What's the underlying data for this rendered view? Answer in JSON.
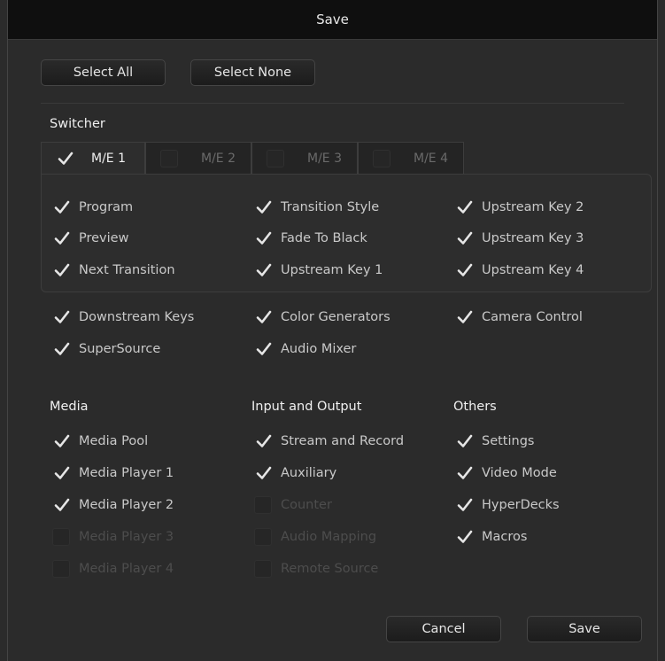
{
  "window": {
    "title": "Save"
  },
  "top_buttons": {
    "select_all": "Select All",
    "select_none": "Select None"
  },
  "switcher": {
    "title": "Switcher",
    "tabs": [
      {
        "label": "M/E 1",
        "checked": true
      },
      {
        "label": "M/E 2",
        "checked": false
      },
      {
        "label": "M/E 3",
        "checked": false
      },
      {
        "label": "M/E 4",
        "checked": false
      }
    ],
    "panel_items": [
      [
        "Program",
        "Transition Style",
        "Upstream Key 2"
      ],
      [
        "Preview",
        "Fade To Black",
        "Upstream Key 3"
      ],
      [
        "Next Transition",
        "Upstream Key 1",
        "Upstream Key 4"
      ]
    ],
    "extra_items": [
      [
        "Downstream Keys",
        "Color Generators",
        "Camera Control"
      ],
      [
        "SuperSource",
        "Audio Mixer"
      ]
    ]
  },
  "media": {
    "title": "Media",
    "items": [
      {
        "label": "Media Pool",
        "checked": true
      },
      {
        "label": "Media Player 1",
        "checked": true
      },
      {
        "label": "Media Player 2",
        "checked": true
      },
      {
        "label": "Media Player 3",
        "checked": false,
        "disabled": true
      },
      {
        "label": "Media Player 4",
        "checked": false,
        "disabled": true
      }
    ]
  },
  "io": {
    "title": "Input and Output",
    "items": [
      {
        "label": "Stream and Record",
        "checked": true
      },
      {
        "label": "Auxiliary",
        "checked": true
      },
      {
        "label": "Counter",
        "checked": false,
        "disabled": true
      },
      {
        "label": "Audio Mapping",
        "checked": false,
        "disabled": true
      },
      {
        "label": "Remote Source",
        "checked": false,
        "disabled": true
      }
    ]
  },
  "others": {
    "title": "Others",
    "items": [
      {
        "label": "Settings",
        "checked": true
      },
      {
        "label": "Video Mode",
        "checked": true
      },
      {
        "label": "HyperDecks",
        "checked": true
      },
      {
        "label": "Macros",
        "checked": true
      }
    ]
  },
  "footer": {
    "cancel": "Cancel",
    "save": "Save"
  },
  "colors": {
    "checkmark": "#e6e6e6",
    "titlebar": "#0f0f0f",
    "background": "#2b2b2b"
  }
}
